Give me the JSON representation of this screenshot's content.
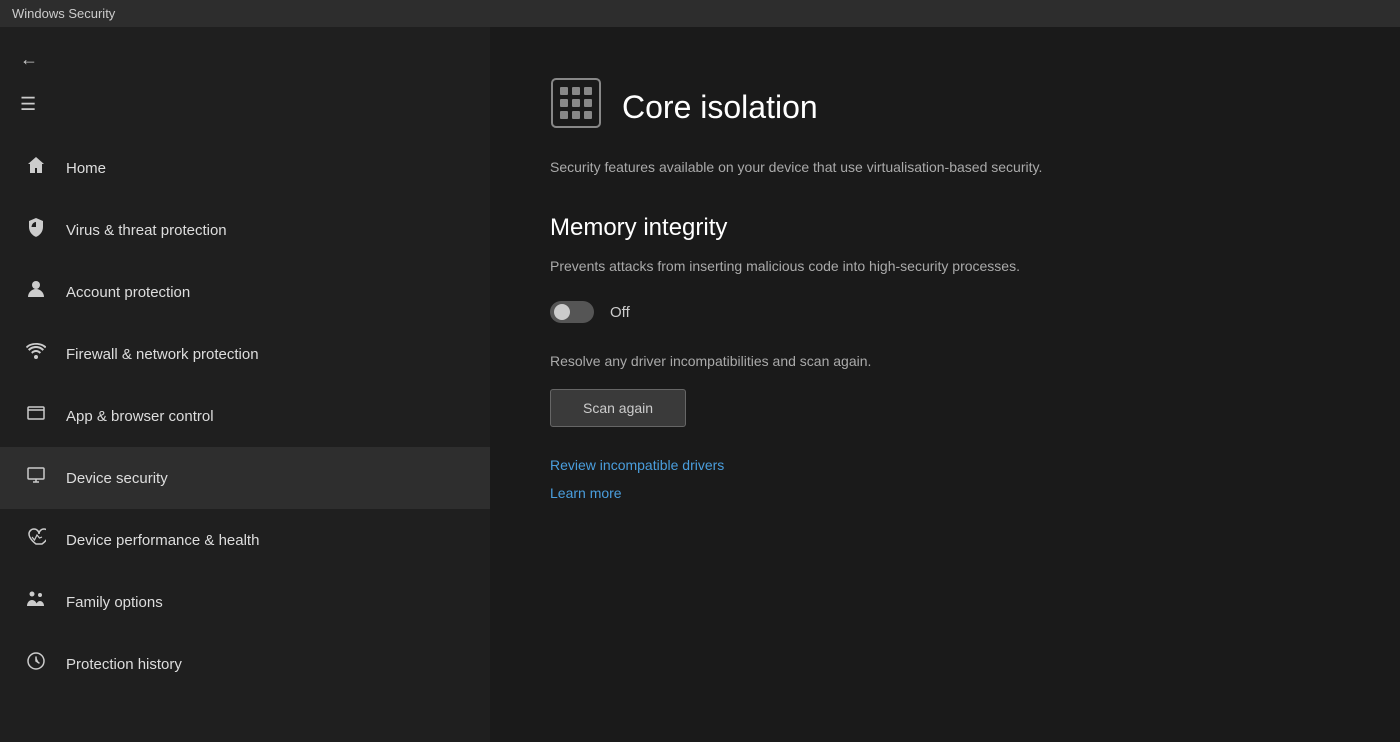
{
  "titleBar": {
    "label": "Windows Security"
  },
  "sidebar": {
    "items": [
      {
        "id": "home",
        "label": "Home",
        "icon": "home"
      },
      {
        "id": "virus",
        "label": "Virus & threat protection",
        "icon": "shield"
      },
      {
        "id": "account",
        "label": "Account protection",
        "icon": "person"
      },
      {
        "id": "firewall",
        "label": "Firewall & network protection",
        "icon": "wifi"
      },
      {
        "id": "app-browser",
        "label": "App & browser control",
        "icon": "window"
      },
      {
        "id": "device-security",
        "label": "Device security",
        "icon": "monitor"
      },
      {
        "id": "device-performance",
        "label": "Device performance & health",
        "icon": "heart"
      },
      {
        "id": "family",
        "label": "Family options",
        "icon": "family"
      },
      {
        "id": "history",
        "label": "Protection history",
        "icon": "clock"
      }
    ]
  },
  "main": {
    "pageTitle": "Core isolation",
    "pageDescription": "Security features available on your device that use virtualisation-based security.",
    "sectionTitle": "Memory integrity",
    "sectionDescription": "Prevents attacks from inserting malicious code into high-security processes.",
    "toggleState": "Off",
    "resolveText": "Resolve any driver incompatibilities and scan again.",
    "scanButton": "Scan again",
    "link1": "Review incompatible drivers",
    "link2": "Learn more"
  }
}
